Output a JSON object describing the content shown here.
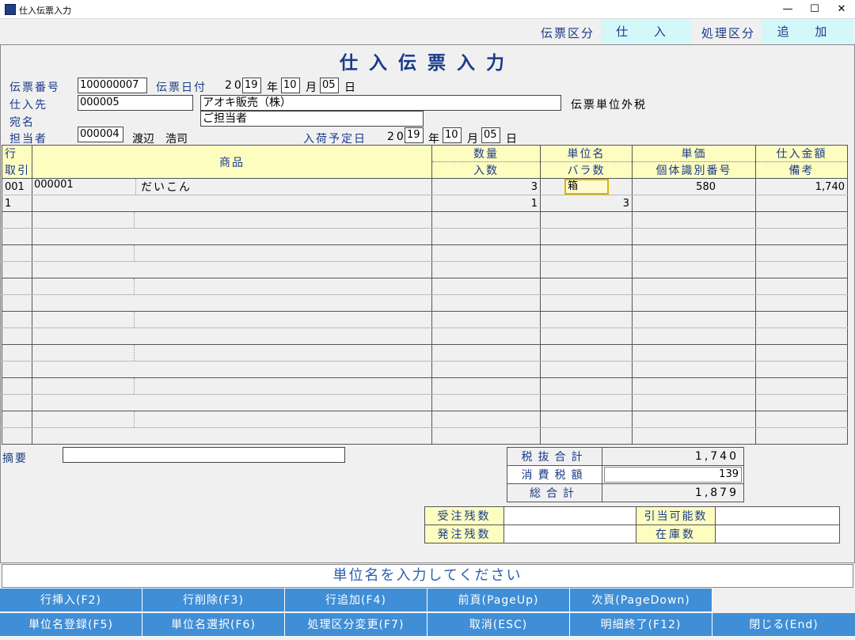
{
  "window": {
    "title": "仕入伝票入力"
  },
  "header": {
    "slip_type_label": "伝票区分",
    "slip_type_value": "仕 入",
    "process_type_label": "処理区分",
    "process_type_value": "追 加"
  },
  "page_title": "仕入伝票入力",
  "form": {
    "slip_no_label": "伝票番号",
    "slip_no": "100000007",
    "slip_date_label": "伝票日付",
    "year_prefix": "20",
    "slip_year": "19",
    "year_label": "年",
    "slip_month": "10",
    "month_label": "月",
    "slip_day": "05",
    "day_label": "日",
    "supplier_label": "仕入先",
    "supplier_code": "000005",
    "supplier_name": "アオキ販売（株）",
    "tax_mode": "伝票単位外税",
    "addressee_label": "宛名",
    "addressee": "ご担当者",
    "staff_label": "担当者",
    "staff_code": "000004",
    "staff_name": "渡辺　浩司",
    "arrival_label": "入荷予定日",
    "arrival_year": "19",
    "arrival_month": "10",
    "arrival_day": "05"
  },
  "grid": {
    "headers": {
      "row_top": "行",
      "row_bottom": "取引",
      "product": "商品",
      "qty_top": "数量",
      "qty_bottom": "入数",
      "unit_top": "単位名",
      "unit_bottom": "バラ数",
      "price_top": "単価",
      "price_bottom": "個体識別番号",
      "amount_top": "仕入金額",
      "amount_bottom": "備考"
    },
    "rows": [
      {
        "line": "001",
        "code": "000001",
        "name": "だいこん",
        "qty": "3",
        "unit": "箱",
        "price": "580",
        "amount": "1,740"
      },
      {
        "line": "1",
        "code": "",
        "name": "",
        "qty": "1",
        "unit": "3",
        "price": "",
        "amount": ""
      }
    ]
  },
  "memo_label": "摘要",
  "totals": {
    "pretax_label": "税抜合計",
    "pretax": "1,740",
    "tax_label": "消費税額",
    "tax": "139",
    "total_label": "総合計",
    "total": "1,879"
  },
  "stock": {
    "order_rem_label": "受注残数",
    "purchase_rem_label": "発注残数",
    "allocatable_label": "引当可能数",
    "stock_label": "在庫数"
  },
  "message": "単位名を入力してください",
  "buttons": {
    "row1": [
      "行挿入(F2)",
      "行削除(F3)",
      "行追加(F4)",
      "前頁(PageUp)",
      "次頁(PageDown)"
    ],
    "row2": [
      "単位名登録(F5)",
      "単位名選択(F6)",
      "処理区分変更(F7)",
      "取消(ESC)",
      "明細終了(F12)",
      "閉じる(End)"
    ]
  },
  "colors": {
    "accent": "#3f8ed6",
    "header_fill": "#fdfdc0",
    "status_fill": "#d4f8fa",
    "label_text": "#1a3a8a"
  }
}
